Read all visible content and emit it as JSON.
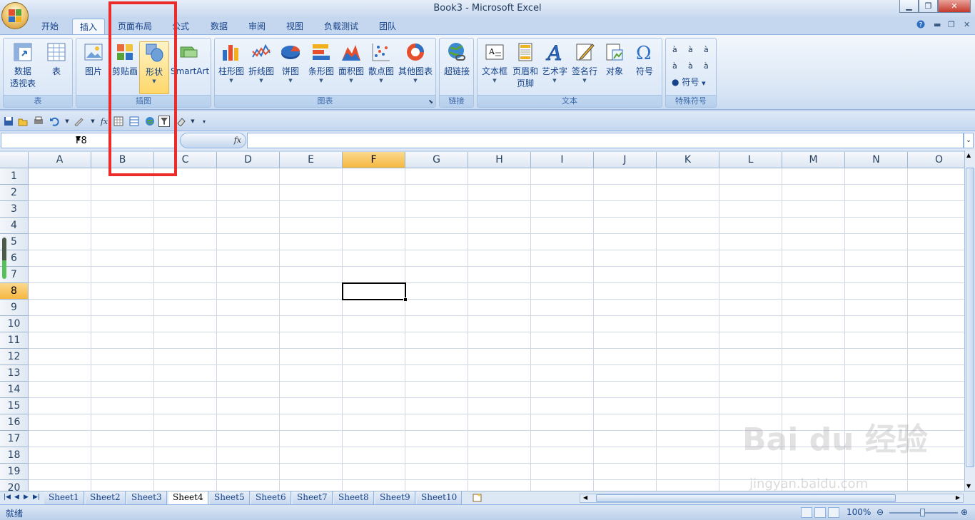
{
  "window": {
    "title": "Book3 - Microsoft Excel"
  },
  "tabs": [
    "开始",
    "插入",
    "页面布局",
    "公式",
    "数据",
    "审阅",
    "视图",
    "负载测试",
    "团队"
  ],
  "active_tab": "插入",
  "ribbon": {
    "groups": [
      {
        "label": "表",
        "buttons": [
          "数据\n透视表",
          "表"
        ]
      },
      {
        "label": "插图",
        "buttons": [
          "图片",
          "剪贴画",
          "形状",
          "SmartArt"
        ]
      },
      {
        "label": "图表",
        "buttons": [
          "柱形图",
          "折线图",
          "饼图",
          "条形图",
          "面积图",
          "散点图",
          "其他图表"
        ]
      },
      {
        "label": "链接",
        "buttons": [
          "超链接"
        ]
      },
      {
        "label": "文本",
        "buttons": [
          "文本框",
          "页眉和\n页脚",
          "艺术字",
          "签名行",
          "对象",
          "符号"
        ]
      },
      {
        "label": "特殊符号",
        "buttons": [
          "à",
          "à",
          "à",
          "à",
          "à",
          "à",
          "符号"
        ]
      }
    ],
    "highlighted_button": "形状"
  },
  "formula_bar": {
    "name_box": "F8",
    "fx_label": "fx",
    "formula": ""
  },
  "columns": [
    "A",
    "B",
    "C",
    "D",
    "E",
    "F",
    "G",
    "H",
    "I",
    "J",
    "K",
    "L",
    "M",
    "N",
    "O"
  ],
  "rows": [
    "1",
    "2",
    "3",
    "4",
    "5",
    "6",
    "7",
    "8",
    "9",
    "10",
    "11",
    "12",
    "13",
    "14",
    "15",
    "16",
    "17",
    "18",
    "19",
    "20"
  ],
  "active_cell": {
    "col": "F",
    "row": "8"
  },
  "sheets": [
    "Sheet1",
    "Sheet2",
    "Sheet3",
    "Sheet4",
    "Sheet5",
    "Sheet6",
    "Sheet7",
    "Sheet8",
    "Sheet9",
    "Sheet10"
  ],
  "active_sheet": "Sheet4",
  "status": {
    "text": "就绪",
    "zoom": "100%"
  },
  "watermark": {
    "text": "Bai du 经验",
    "url": "jingyan.baidu.com"
  },
  "colors": {
    "annotation_box": "#ec2b2b",
    "ribbon_bg": "#dbe7f5",
    "selected_header": "#f5b73f"
  }
}
